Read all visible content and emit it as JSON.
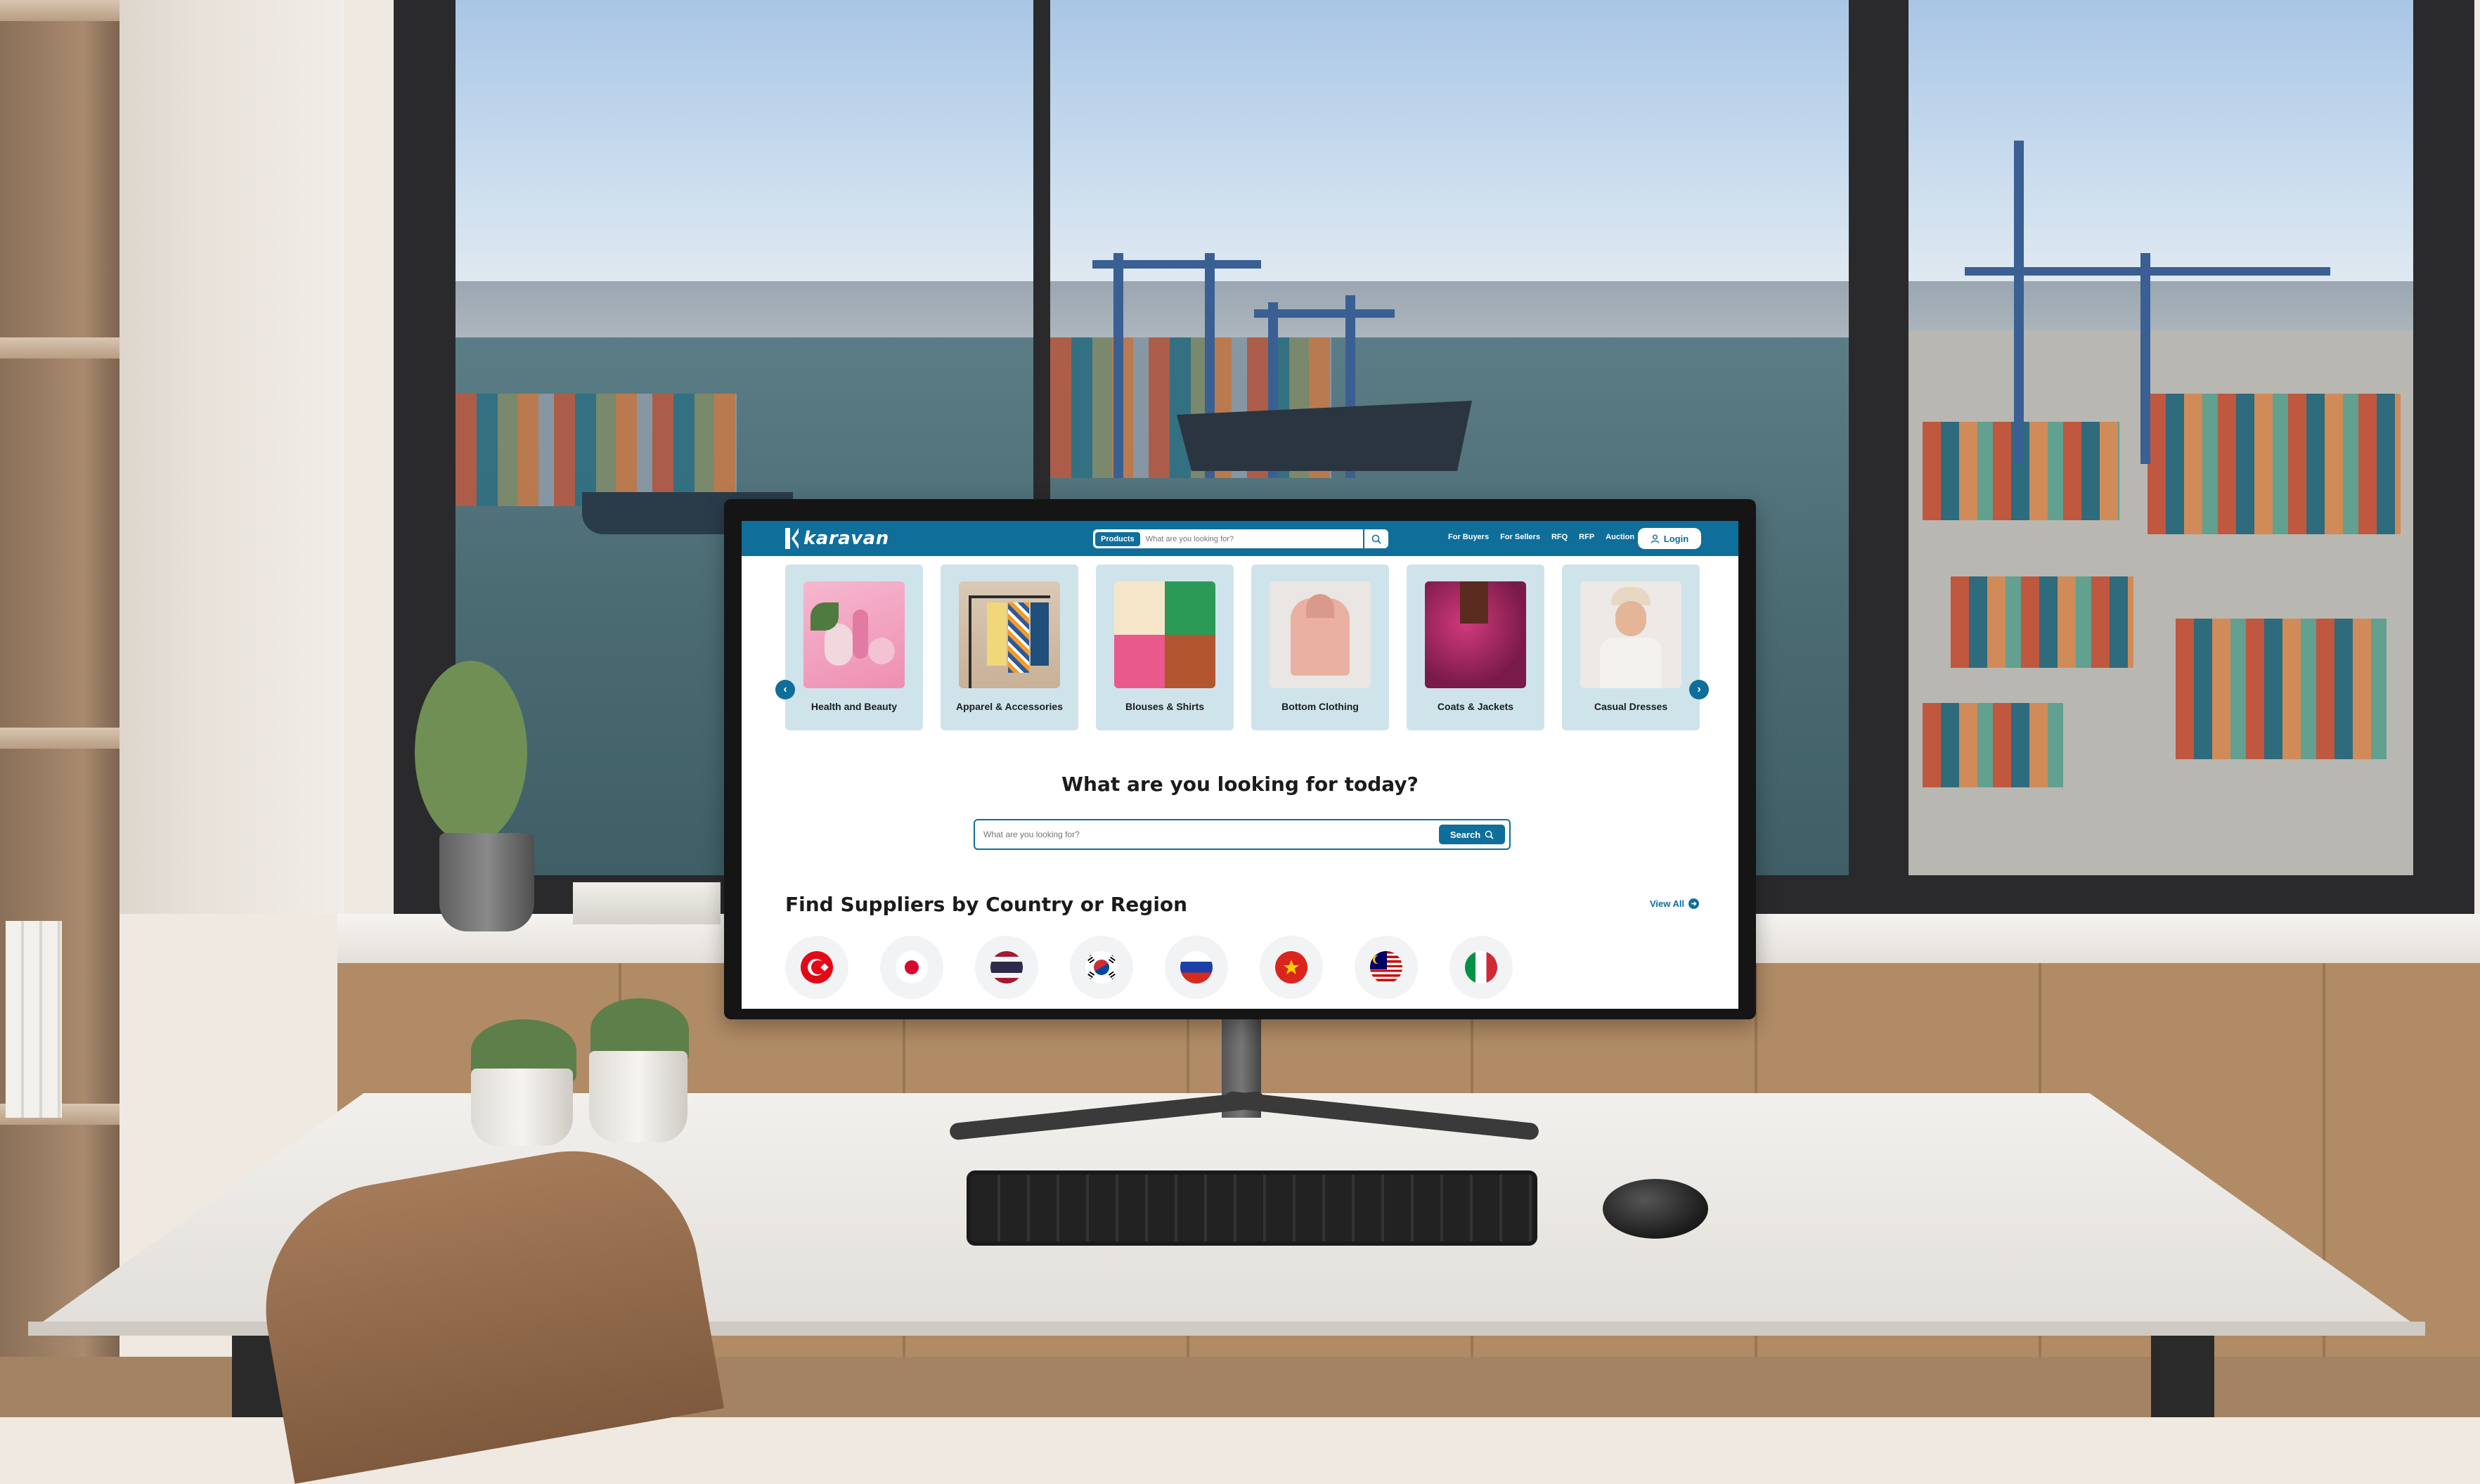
{
  "brand": {
    "name": "karavan"
  },
  "header": {
    "search_category": "Products",
    "search_placeholder": "What are you looking for?",
    "nav": [
      "For Buyers",
      "For Sellers",
      "RFQ",
      "RFP",
      "Auction"
    ],
    "login_label": "Login"
  },
  "categories": [
    {
      "label": "Health and Beauty",
      "icon": "beauty-products-image"
    },
    {
      "label": "Apparel & Accessories",
      "icon": "clothing-rack-image"
    },
    {
      "label": "Blouses & Shirts",
      "icon": "shirts-collage-image"
    },
    {
      "label": "Bottom Clothing",
      "icon": "hoodie-image"
    },
    {
      "label": "Coats & Jackets",
      "icon": "sequin-jacket-image"
    },
    {
      "label": "Casual Dresses",
      "icon": "casual-woman-image"
    }
  ],
  "search": {
    "headline": "What are you looking for today?",
    "placeholder": "What are you looking for?",
    "button_label": "Search"
  },
  "suppliers": {
    "title": "Find Suppliers by Country or Region",
    "view_all_label": "View All",
    "flags": [
      "turkey-flag",
      "japan-flag",
      "thailand-flag",
      "south-korea-flag",
      "russia-flag",
      "vietnam-flag",
      "malaysia-flag",
      "italy-flag"
    ]
  },
  "colors": {
    "brand_blue": "#0f6e9a",
    "card_bg": "#cfe3ea"
  }
}
